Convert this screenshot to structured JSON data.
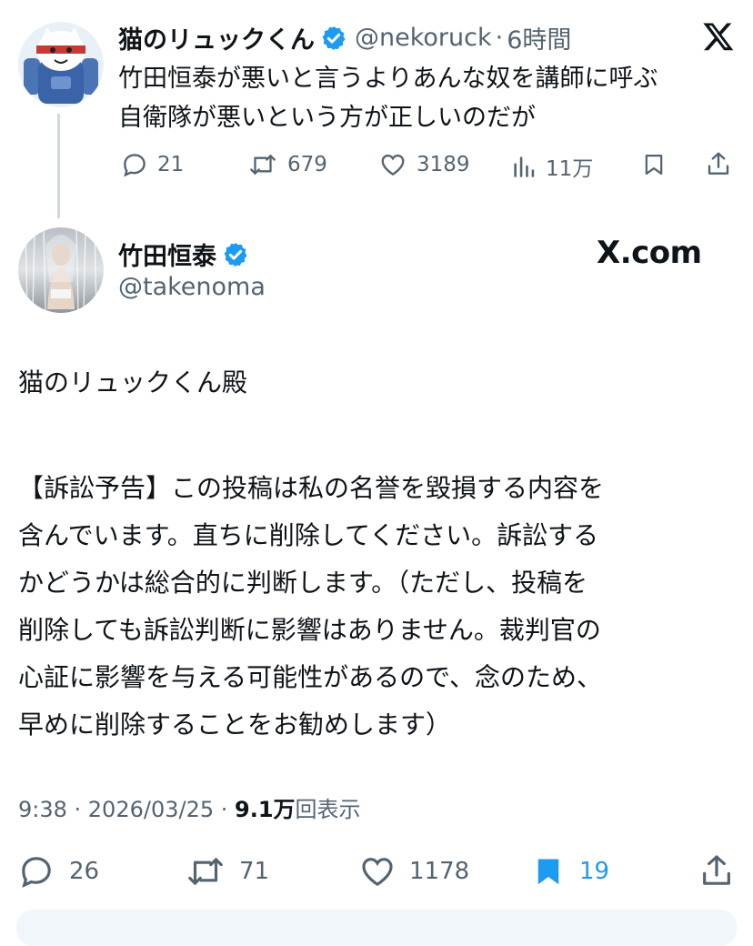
{
  "quoted": {
    "display_name": "猫のリュックくん",
    "handle": "@nekoruck",
    "time": "6時間",
    "text_lines": [
      "竹田恒泰が悪いと言うよりあんな奴を講師に呼ぶ",
      "自衛隊が悪いという方が正しいのだが"
    ],
    "replies": "21",
    "retweets": "679",
    "likes": "3189",
    "views": "11万"
  },
  "main": {
    "display_name": "竹田恒泰",
    "handle": "@takenoma",
    "brand": "X.com",
    "addressee": "猫のリュックくん殿",
    "body_lines": [
      "【訴訟予告】この投稿は私の名誉を毀損する内容を",
      "含んでいます。直ちに削除してください。訴訟する",
      "かどうかは総合的に判断します。（ただし、投稿を",
      "削除しても訴訟判断に影響はありません。裁判官の",
      "心証に影響を与える可能性があるので、念のため、",
      "早めに削除することをお勧めします）"
    ],
    "timestamp": "9:38 · 2026/03/25 · ",
    "views_count": "9.1万",
    "views_label": "回表示",
    "replies": "26",
    "retweets": "71",
    "likes": "1178",
    "bookmarks": "19"
  },
  "colors": {
    "verified": "#1d9bf0",
    "bookmark_active": "#1d9bf0",
    "muted": "#536471",
    "thread_line": "#cfd9de"
  }
}
